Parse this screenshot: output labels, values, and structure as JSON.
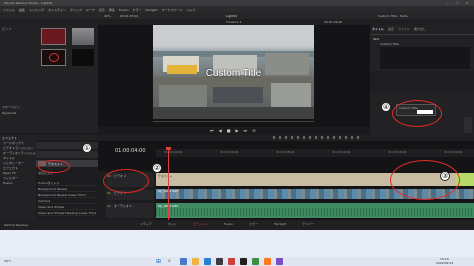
{
  "window": {
    "title": "Davinci Resolve Studio - Light01",
    "controls": [
      "—",
      "☐",
      "✕"
    ]
  },
  "menu": {
    "items": [
      "DaVinci Resolve",
      "ファイル",
      "編集",
      "トリミング",
      "タイムライン",
      "クリップ",
      "マーク",
      "表示",
      "再生",
      "Fusion",
      "カラー",
      "Fairlight",
      "ワークスペース",
      "ヘルプ"
    ]
  },
  "toolbar": {
    "project_name": "Light01",
    "timeline_name": "Timeline 1",
    "zoom": "40%",
    "timecode_top": "00:01:05:04",
    "inspector_title": "Custom Title - Text+",
    "inspector_timecode": "00:01:04:00"
  },
  "media_pool": {
    "bins": [
      "ビン 1",
      "マスター"
    ],
    "label_a": "スマートビン",
    "label_b": "Keywords"
  },
  "effects": {
    "header": "エフェクト",
    "categories": [
      "ツールボックス",
      "ビデオトランジション",
      "オーディオトランジション",
      "タイトル",
      "ジェネレーター",
      "エフェクト",
      "Open FX",
      "フィルター",
      "Fusion"
    ],
    "favorites": "お気に入り",
    "titles_label": "タイトル",
    "selected_title": "テキスト+",
    "list_items": [
      "Fusionタイトル",
      "Background Reveal",
      "Background Reveal Lower Third",
      "Call Out",
      "Clean and Simple",
      "Clean and Simple Heading Lower Third"
    ]
  },
  "viewer": {
    "title_overlay": "Custom Title",
    "transport": [
      "⏮",
      "◀",
      "■",
      "▶",
      "⏭",
      "⟲"
    ]
  },
  "inspector": {
    "tabs": [
      "タイトル",
      "設定",
      "ファイル",
      "書き出し"
    ],
    "section": "Text",
    "field_label": "Custom Title",
    "field_rows": [
      "サイズ",
      "トラッキング",
      "カラー"
    ],
    "popup_label": "Custom Title",
    "popup_value": "0.5"
  },
  "timeline": {
    "timecode": "01:00:04:00",
    "ruler_ticks": [
      "01:00:00:00",
      "01:00:04:00",
      "01:00:08:00",
      "01:00:12:00",
      "01:00:16:00",
      "01:00:20:00"
    ],
    "tracks": [
      {
        "id": "V2",
        "name": "ビデオ 2",
        "clip": "テキスト+"
      },
      {
        "id": "V1",
        "name": "ビデオ 1",
        "clip": "DJI_0001.MP4"
      },
      {
        "id": "A1",
        "name": "オーディオ 1",
        "clip": "DJI_0001.MP4"
      }
    ]
  },
  "pages": [
    "メディア",
    "カット",
    "エディット",
    "Fusion",
    "カラー",
    "Fairlight",
    "デリバー"
  ],
  "annotations": [
    "①",
    "②",
    "③",
    "④"
  ],
  "taskbar": {
    "search_placeholder": "検索",
    "weather": "28°C",
    "time": "14:19",
    "date": "2022/09/13"
  },
  "colors": {
    "accent_red": "#e52a2a",
    "clip_beige": "#c7bda2",
    "clip_green": "#3f8a63",
    "clip_video": "#5c8aa8",
    "playhead": "#e0403a"
  }
}
